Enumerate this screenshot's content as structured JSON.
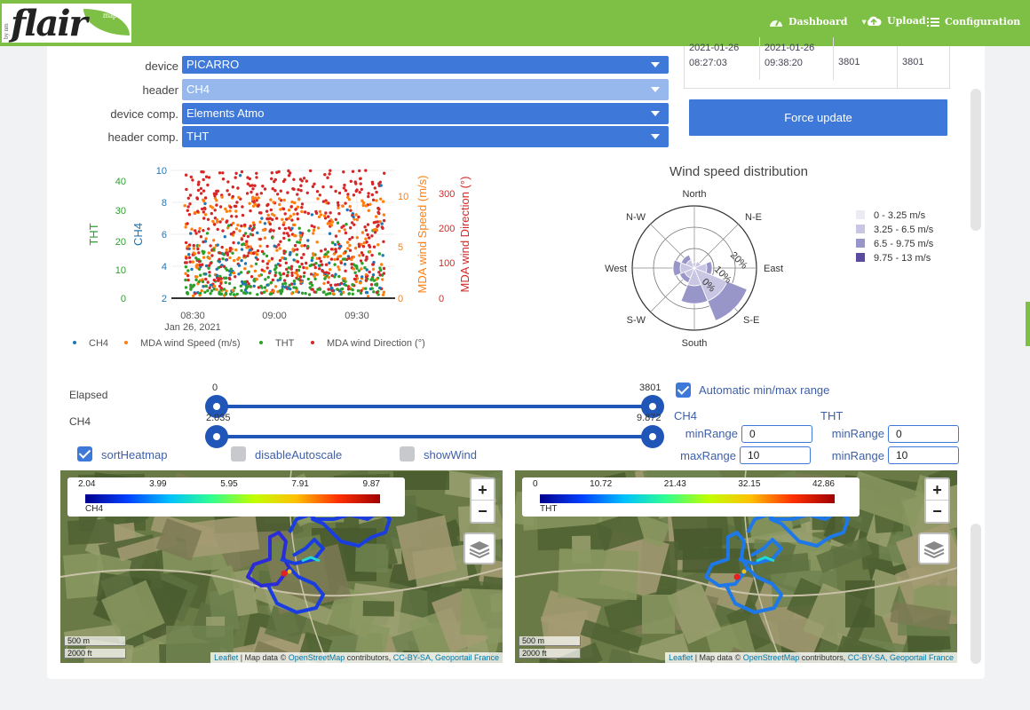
{
  "nav": {
    "dashboard": "Dashboard",
    "upload": "Upload",
    "configuration": "Configuration",
    "logo": {
      "byline": "by nm",
      "brand": "flair",
      "map": "map"
    }
  },
  "selectors": [
    {
      "label": "device",
      "value": "PICARRO"
    },
    {
      "label": "header",
      "value": "CH4"
    },
    {
      "label": "device comp.",
      "value": "Elements Atmo"
    },
    {
      "label": "header comp.",
      "value": "THT"
    }
  ],
  "info_table": {
    "cells": [
      [
        "2021-01-26",
        "08:27:03"
      ],
      [
        "2021-01-26",
        "09:38:20"
      ],
      [
        "3801"
      ],
      [
        "3801"
      ]
    ]
  },
  "force_update": "Force update",
  "timeseries": {
    "yaxes": {
      "tht": {
        "label": "THT",
        "ticks": [
          "0",
          "10",
          "20",
          "30",
          "40"
        ],
        "color": "#2ca02c"
      },
      "ch4": {
        "label": "CH4",
        "ticks": [
          "2",
          "4",
          "6",
          "8",
          "10"
        ],
        "color": "#1f77b4"
      },
      "wind_speed": {
        "label": "MDA wind Speed (m/s)",
        "ticks": [
          "0",
          "5",
          "10"
        ],
        "color": "#ff7f0e"
      },
      "wind_dir": {
        "label": "MDA wind Direction (°)",
        "ticks": [
          "0",
          "100",
          "200",
          "300"
        ],
        "color": "#d62728"
      }
    },
    "xticks": [
      "08:30",
      "09:00",
      "09:30"
    ],
    "xdate": "Jan 26, 2021",
    "legend": [
      "CH4",
      "MDA wind Speed (m/s)",
      "THT",
      "MDA wind Direction (°)"
    ]
  },
  "chart_data": {
    "type": "scatter",
    "x_range": [
      "08:15",
      "09:45"
    ],
    "series": [
      {
        "name": "CH4",
        "y_range": [
          2,
          10
        ],
        "color": "#1f77b4"
      },
      {
        "name": "MDA wind Speed (m/s)",
        "y_range": [
          0,
          12.5
        ],
        "color": "#ff7f0e"
      },
      {
        "name": "THT",
        "y_range": [
          0,
          42
        ],
        "color": "#2ca02c"
      },
      {
        "name": "MDA wind Direction (°)",
        "y_range": [
          0,
          350
        ],
        "color": "#d62728"
      }
    ]
  },
  "polar": {
    "title": "Wind speed distribution",
    "directions": [
      "North",
      "N-E",
      "East",
      "S-E",
      "South",
      "S-W",
      "West",
      "N-W"
    ],
    "radial_ticks": [
      "0%",
      "10%",
      "20%"
    ],
    "legend": [
      {
        "label": "0 - 3.25 m/s",
        "color": "#ecebf4"
      },
      {
        "label": "3.25 - 6.5 m/s",
        "color": "#c8c6e2"
      },
      {
        "label": "6.5 - 9.75 m/s",
        "color": "#9896c8"
      },
      {
        "label": "9.75 - 13 m/s",
        "color": "#5a4aa0"
      }
    ]
  },
  "sliders": {
    "elapsed": {
      "label": "Elapsed",
      "min": "0",
      "max": "3801"
    },
    "ch4": {
      "label": "CH4",
      "min": "2.035",
      "max": "9.872"
    }
  },
  "auto_range": "Automatic min/max range",
  "range_ch4": {
    "title": "CH4",
    "min_label": "minRange",
    "min": "0",
    "max_label": "maxRange",
    "max": "10"
  },
  "range_tht": {
    "title": "THT",
    "min_label": "minRange",
    "min": "0",
    "max_label": "minRange",
    "max": "10"
  },
  "checkboxes": {
    "sort": "sortHeatmap",
    "autoscale": "disableAutoscale",
    "wind": "showWind"
  },
  "map_ch4": {
    "ticks": [
      "2.04",
      "3.99",
      "5.95",
      "7.91",
      "9.87"
    ],
    "name": "CH4",
    "scale_m": "500 m",
    "scale_ft": "2000 ft"
  },
  "map_tht": {
    "ticks": [
      "0",
      "10.72",
      "21.43",
      "32.15",
      "42.86"
    ],
    "name": "THT",
    "scale_m": "500 m",
    "scale_ft": "2000 ft"
  },
  "attribution": {
    "leaflet": "Leaflet",
    "text1": " | Map data © ",
    "osm": "OpenStreetMap",
    "text2": " contributors, ",
    "links": "CC-BY-SA, Geoportail France"
  },
  "zoom": {
    "in": "+",
    "out": "−"
  }
}
